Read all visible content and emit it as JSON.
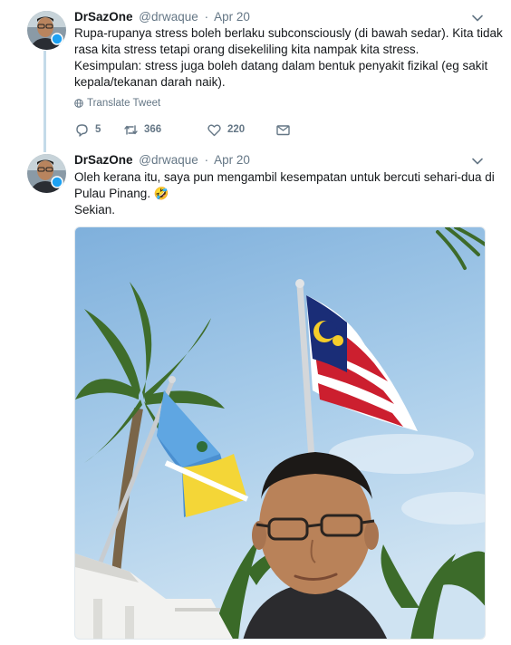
{
  "tweets": [
    {
      "name": "DrSazOne",
      "handle": "@drwaque",
      "separator": "·",
      "date": "Apr 20",
      "text_lines": [
        "Rupa-rupanya stress boleh berlaku subconsciously (di bawah sedar). Kita tidak",
        "rasa kita stress tetapi orang disekeliling kita nampak kita stress.",
        "Kesimpulan: stress juga boleh datang dalam bentuk penyakit fizikal (eg sakit",
        "kepala/tekanan darah naik)."
      ],
      "translate_label": "Translate Tweet",
      "reply_count": "5",
      "retweet_count": "366",
      "like_count": "220"
    },
    {
      "name": "DrSazOne",
      "handle": "@drwaque",
      "separator": "·",
      "date": "Apr 20",
      "text_lines": [
        "Oleh kerana itu, saya pun mengambil kesempatan untuk bercuti sehari-dua di",
        "Pulau Pinang. 🤣",
        "Sekian."
      ]
    }
  ],
  "colors": {
    "text": "#14171a",
    "secondary": "#657786",
    "thread_line": "#c4dbe9"
  },
  "icons": [
    "chevron-down-icon",
    "globe-icon",
    "reply-icon",
    "retweet-icon",
    "like-icon",
    "message-icon"
  ]
}
